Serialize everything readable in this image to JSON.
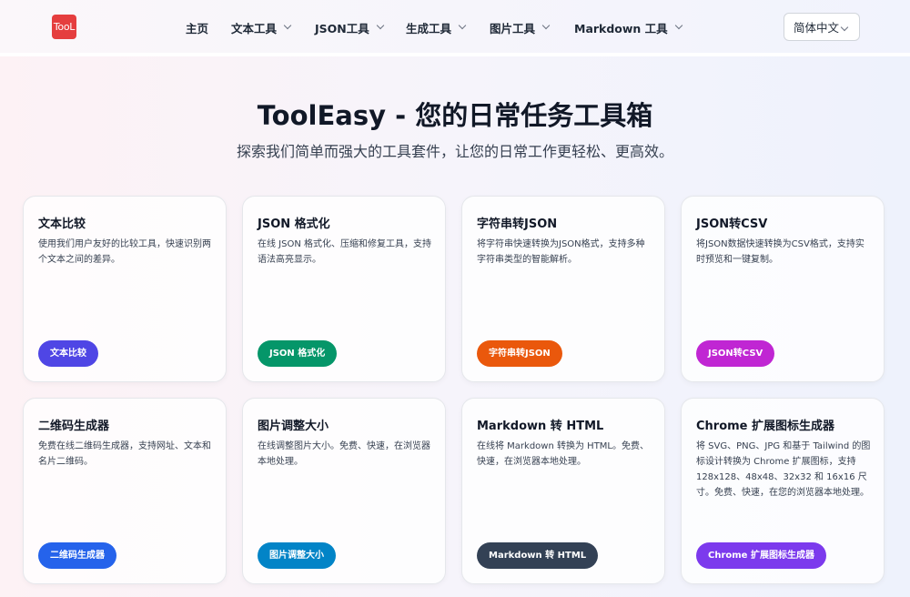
{
  "header": {
    "logo_text": "TooL",
    "nav": [
      {
        "label": "主页",
        "dropdown": false
      },
      {
        "label": "文本工具",
        "dropdown": true
      },
      {
        "label": "JSON工具",
        "dropdown": true
      },
      {
        "label": "生成工具",
        "dropdown": true
      },
      {
        "label": "图片工具",
        "dropdown": true
      },
      {
        "label": "Markdown 工具",
        "dropdown": true
      }
    ],
    "language": "简体中文"
  },
  "hero": {
    "title": "ToolEasy - 您的日常任务工具箱",
    "subtitle": "探索我们简单而强大的工具套件，让您的日常工作更轻松、更高效。"
  },
  "cards": [
    {
      "title": "文本比较",
      "desc": "使用我们用户友好的比较工具，快速识别两个文本之间的差异。",
      "button": "文本比较",
      "color": "#4f46e5"
    },
    {
      "title": "JSON 格式化",
      "desc": "在线 JSON 格式化、压缩和修复工具，支持语法高亮显示。",
      "button": "JSON 格式化",
      "color": "#059669"
    },
    {
      "title": "字符串转JSON",
      "desc": "将字符串快速转换为JSON格式，支持多种字符串类型的智能解析。",
      "button": "字符串转JSON",
      "color": "#ea580c"
    },
    {
      "title": "JSON转CSV",
      "desc": "将JSON数据快速转换为CSV格式，支持实时预览和一键复制。",
      "button": "JSON转CSV",
      "color": "#c026d3"
    },
    {
      "title": "二维码生成器",
      "desc": "免费在线二维码生成器，支持网址、文本和名片二维码。",
      "button": "二维码生成器",
      "color": "#2563eb"
    },
    {
      "title": "图片调整大小",
      "desc": "在线调整图片大小。免费、快速，在浏览器本地处理。",
      "button": "图片调整大小",
      "color": "#0284c7"
    },
    {
      "title": "Markdown 转 HTML",
      "desc": "在线将 Markdown 转换为 HTML。免费、快速，在浏览器本地处理。",
      "button": "Markdown 转 HTML",
      "color": "#334155"
    },
    {
      "title": "Chrome 扩展图标生成器",
      "desc": "将 SVG、PNG、JPG 和基于 Tailwind 的图标设计转换为 Chrome 扩展图标，支持 128x128、48x48、32x32 和 16x16 尺寸。免费、快速，在您的浏览器本地处理。",
      "button": "Chrome 扩展图标生成器",
      "color": "#7c3aed"
    }
  ]
}
